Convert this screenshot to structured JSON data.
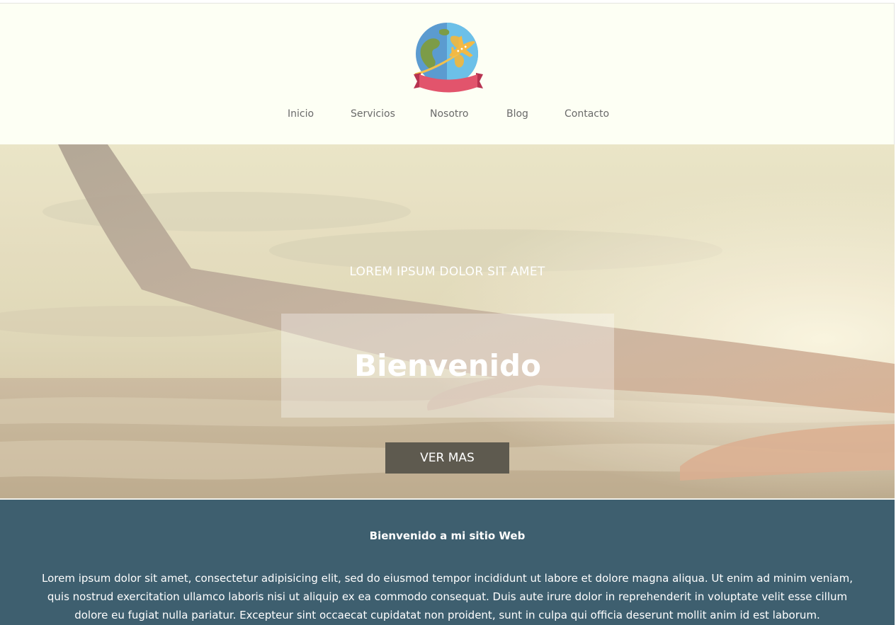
{
  "header": {
    "logo_icon": "globe-airplane-icon",
    "nav": [
      "Inicio",
      "Servicios",
      "Nosotro",
      "Blog",
      "Contacto"
    ]
  },
  "hero": {
    "subtitle": "LOREM IPSUM DOLOR SIT AMET",
    "title": "Bienvenido",
    "button": "VER MAS"
  },
  "welcome": {
    "title": "Bienvenido a mi sitio Web",
    "text": "Lorem ipsum dolor sit amet, consectetur adipisicing elit, sed do eiusmod tempor incididunt ut labore et dolore magna aliqua. Ut enim ad minim veniam, quis nostrud exercitation ullamco laboris nisi ut aliquip ex ea commodo consequat. Duis aute irure dolor in reprehenderit in voluptate velit esse cillum dolore eu fugiat nulla pariatur. Excepteur sint occaecat cupidatat non proident, sunt in culpa qui officia deserunt mollit anim id est laborum."
  },
  "colors": {
    "header_bg": "#fdfff4",
    "section_bg": "#3e5f6f",
    "button_bg": "#5e5a4f",
    "nav_text": "#6a6a6a"
  }
}
